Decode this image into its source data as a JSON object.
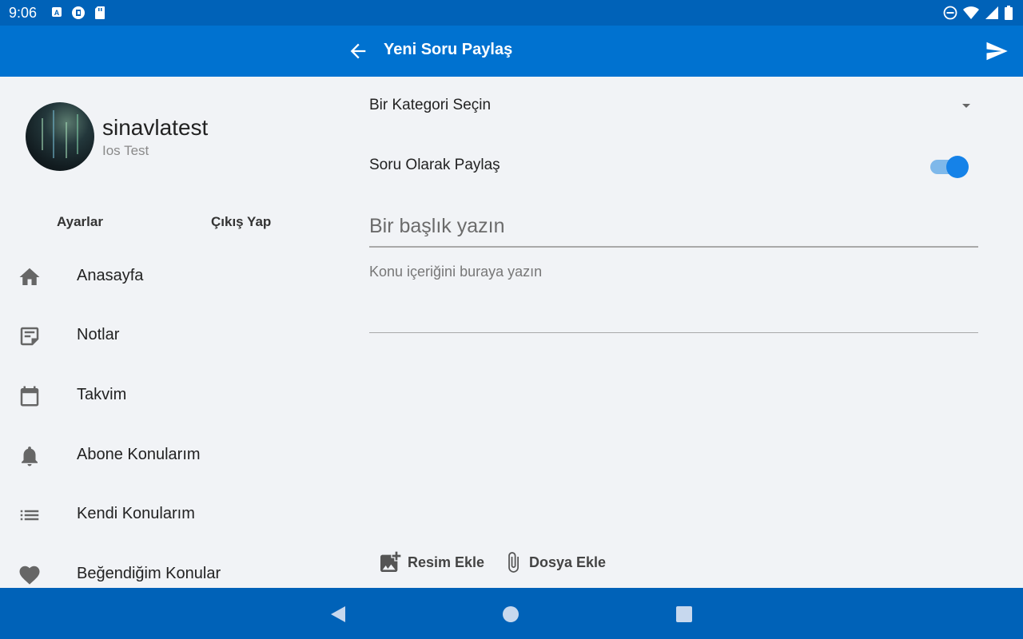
{
  "status_bar": {
    "time": "9:06",
    "icons": [
      "a-badge-icon",
      "cast-icon",
      "sd-card-icon",
      "do-not-disturb-icon",
      "wifi-icon",
      "signal-icon",
      "battery-icon"
    ]
  },
  "app_bar": {
    "title": "Yeni Soru Paylaş",
    "back_icon": "arrow-left-icon",
    "send_icon": "send-icon",
    "color": "#0072d0"
  },
  "profile": {
    "username": "sinavlatest",
    "subtitle": "Ios Test"
  },
  "sidebar": {
    "settings_label": "Ayarlar",
    "logout_label": "Çıkış Yap",
    "items": [
      {
        "label": "Anasayfa",
        "icon": "home-icon"
      },
      {
        "label": "Notlar",
        "icon": "note-icon"
      },
      {
        "label": "Takvim",
        "icon": "calendar-icon"
      },
      {
        "label": "Abone Konularım",
        "icon": "bell-icon"
      },
      {
        "label": "Kendi Konularım",
        "icon": "list-icon"
      },
      {
        "label": "Beğendiğim Konular",
        "icon": "heart-icon"
      }
    ]
  },
  "form": {
    "category_placeholder": "Bir Kategori Seçin",
    "share_as_question_label": "Soru Olarak Paylaş",
    "share_as_question_on": true,
    "title_placeholder": "Bir başlık yazın",
    "content_placeholder": "Konu içeriğini buraya yazın",
    "add_image_label": "Resim Ekle",
    "add_file_label": "Dosya Ekle"
  },
  "nav_bar": {
    "back": "back-triangle-icon",
    "home": "home-circle-icon",
    "recents": "recents-square-icon"
  }
}
